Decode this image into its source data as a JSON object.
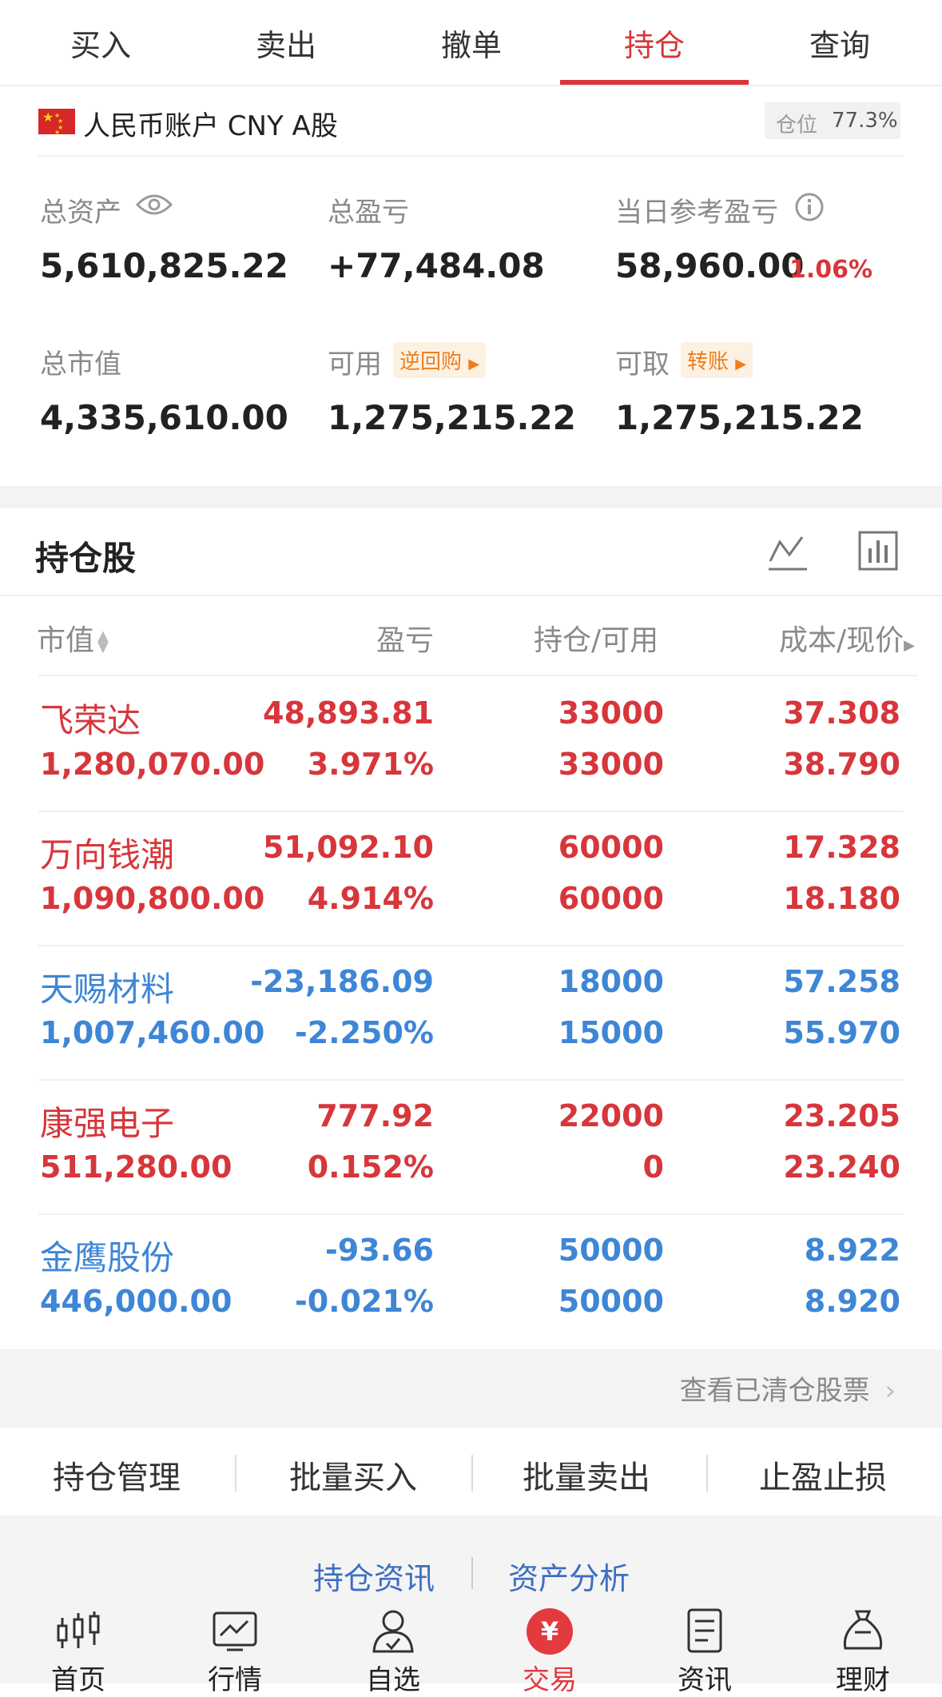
{
  "tabs": [
    {
      "label": "买入"
    },
    {
      "label": "卖出"
    },
    {
      "label": "撤单"
    },
    {
      "label": "持仓"
    },
    {
      "label": "查询"
    }
  ],
  "account": {
    "name": "人民币账户 CNY A股",
    "position_label": "仓位",
    "position_value": "77.3%"
  },
  "summary": {
    "total_assets_label": "总资产",
    "total_assets": "5,610,825.22",
    "total_pl_label": "总盈亏",
    "total_pl": "+77,484.08",
    "daily_pl_label": "当日参考盈亏",
    "daily_pl": "58,960.00",
    "daily_pl_pct": "1.06%",
    "market_value_label": "总市值",
    "market_value": "4,335,610.00",
    "available_label": "可用",
    "available_tag": "逆回购",
    "available": "1,275,215.22",
    "withdrawable_label": "可取",
    "withdrawable_tag": "转账",
    "withdrawable": "1,275,215.22"
  },
  "holdings": {
    "title": "持仓股",
    "headers": {
      "market_value": "市值",
      "pl": "盈亏",
      "position": "持仓/可用",
      "cost": "成本/现价"
    },
    "rows": [
      {
        "name": "飞荣达",
        "market_value": "1,280,070.00",
        "pl": "48,893.81",
        "pl_pct": "3.971%",
        "position": "33000",
        "available": "33000",
        "cost": "37.308",
        "price": "38.790",
        "color": "#d7363b"
      },
      {
        "name": "万向钱潮",
        "market_value": "1,090,800.00",
        "pl": "51,092.10",
        "pl_pct": "4.914%",
        "position": "60000",
        "available": "60000",
        "cost": "17.328",
        "price": "18.180",
        "color": "#d7363b"
      },
      {
        "name": "天赐材料",
        "market_value": "1,007,460.00",
        "pl": "-23,186.09",
        "pl_pct": "-2.250%",
        "position": "18000",
        "available": "15000",
        "cost": "57.258",
        "price": "55.970",
        "color": "#3e86d6"
      },
      {
        "name": "康强电子",
        "market_value": "511,280.00",
        "pl": "777.92",
        "pl_pct": "0.152%",
        "position": "22000",
        "available": "0",
        "cost": "23.205",
        "price": "23.240",
        "color": "#d7363b"
      },
      {
        "name": "金鹰股份",
        "market_value": "446,000.00",
        "pl": "-93.66",
        "pl_pct": "-0.021%",
        "position": "50000",
        "available": "50000",
        "cost": "8.922",
        "price": "8.920",
        "color": "#3e86d6"
      }
    ]
  },
  "cleared_link": "查看已清仓股票",
  "actions": [
    "持仓管理",
    "批量买入",
    "批量卖出",
    "止盈止损"
  ],
  "info_links": [
    "持仓资讯",
    "资产分析"
  ],
  "bottom_nav": [
    {
      "label": "首页",
      "icon": "candlestick-icon"
    },
    {
      "label": "行情",
      "icon": "chart-icon"
    },
    {
      "label": "自选",
      "icon": "user-check-icon"
    },
    {
      "label": "交易",
      "icon": "yuan-icon"
    },
    {
      "label": "资讯",
      "icon": "document-icon"
    },
    {
      "label": "理财",
      "icon": "money-bag-icon"
    }
  ],
  "colors": {
    "up": "#d7363b",
    "down": "#3e86d6",
    "accent": "#d7363b",
    "tag": "#ef7d1a"
  }
}
